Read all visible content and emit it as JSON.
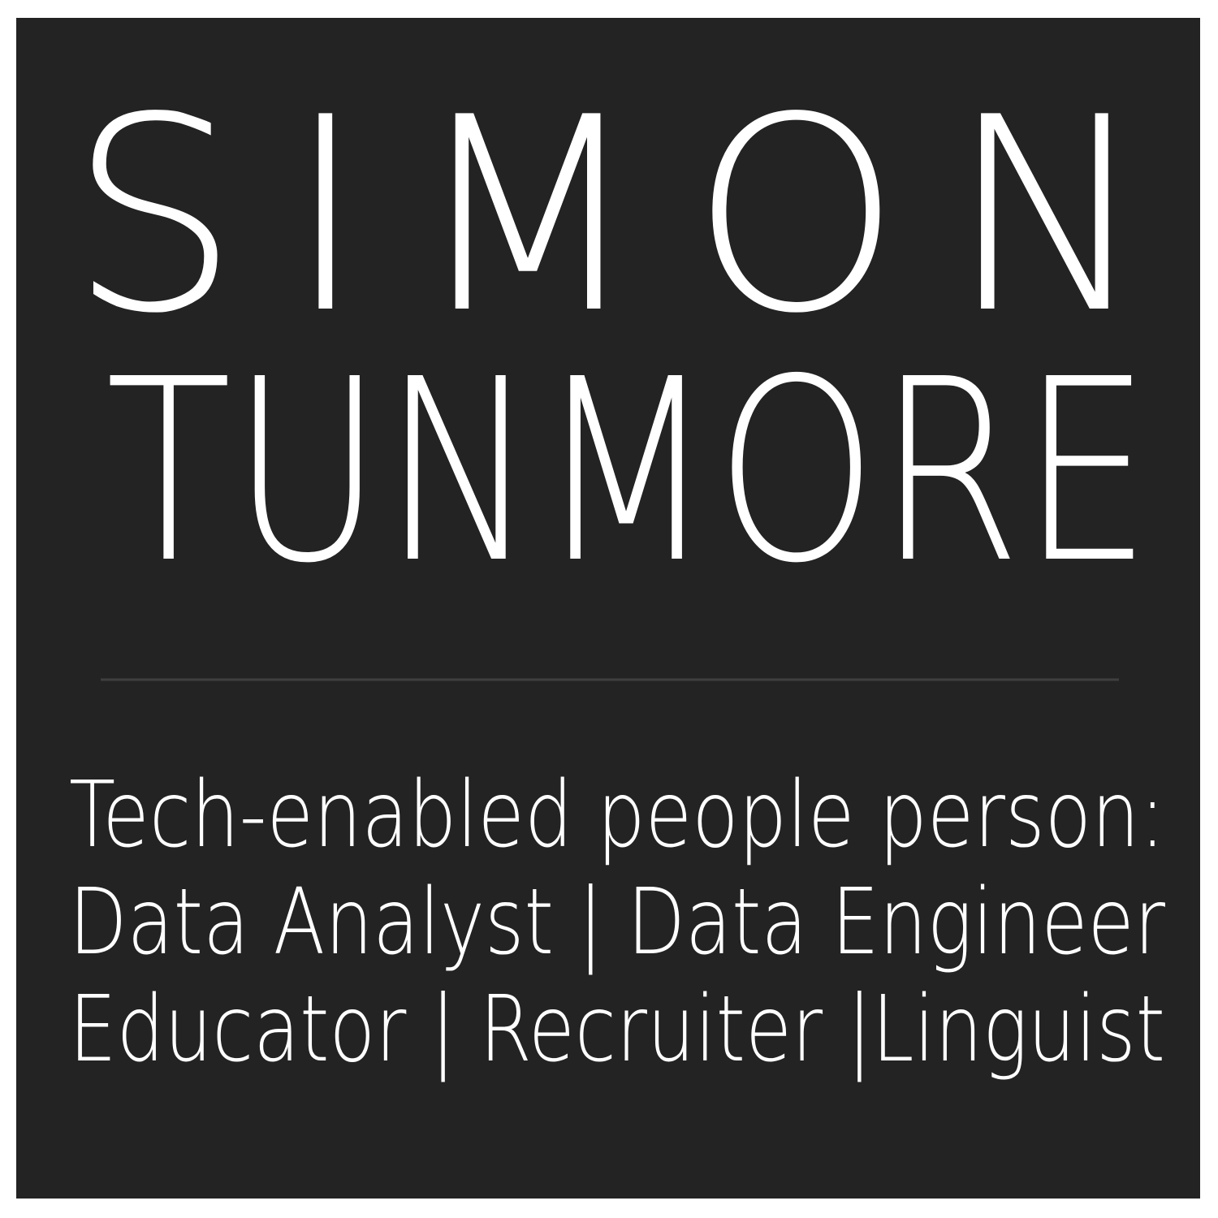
{
  "name": {
    "first": "SIMON",
    "last": "TUNMORE"
  },
  "tagline": {
    "line1": "Tech-enabled people person:",
    "line2": "Data Analyst | Data Engineer",
    "line3": "Educator | Recruiter |Linguist"
  },
  "colors": {
    "background": "#232323",
    "text": "#ffffff",
    "divider": "#3f3f3f",
    "page": "#ffffff"
  }
}
